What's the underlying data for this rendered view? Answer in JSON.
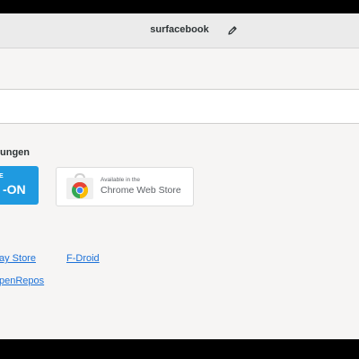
{
  "window": {
    "title": "surfacebook"
  },
  "section": {
    "heading": "ungen"
  },
  "badges": {
    "addon": {
      "small": "HE",
      "big": "-ON"
    },
    "chrome_store": {
      "small": "Available in the",
      "big": "Chrome Web Store"
    }
  },
  "links": [
    {
      "label": "ay Store"
    },
    {
      "label": "F-Droid"
    },
    {
      "label": "penRepos"
    }
  ],
  "icons": {
    "edit": "pencil-icon",
    "store": "chrome-web-store-icon"
  },
  "colors": {
    "accent": "#1c71d8",
    "addon_badge": "#1f9ae0",
    "headerbar": "#ebebeb",
    "background": "#f6f5f4"
  }
}
